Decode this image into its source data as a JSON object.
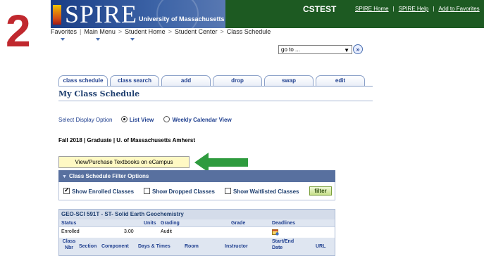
{
  "step_number": "2",
  "header": {
    "logo_text": "SPIRE",
    "logo_subtitle": "University of Massachusetts",
    "environment": "CSTEST",
    "links": [
      "SPIRE Home",
      "SPIRE Help",
      "Add to Favorites"
    ]
  },
  "nav": {
    "favorites": "Favorites",
    "main_menu": "Main Menu",
    "breadcrumb": [
      "Student Home",
      "Student Center",
      "Class Schedule"
    ]
  },
  "goto": {
    "value": "go to ..."
  },
  "tabs": [
    "class schedule",
    "class search",
    "add",
    "drop",
    "swap",
    "edit"
  ],
  "page_title": "My Class Schedule",
  "display_option": {
    "label": "Select Display Option",
    "options": [
      "List View",
      "Weekly Calendar View"
    ],
    "selected": "List View"
  },
  "term": "Fall 2018 | Graduate | U. of Massachusetts Amherst",
  "textbook_button": "View/Purchase Textbooks on eCampus",
  "filter": {
    "heading": "Class Schedule Filter Options",
    "options": [
      {
        "label": "Show Enrolled Classes",
        "checked": true
      },
      {
        "label": "Show Dropped Classes",
        "checked": false
      },
      {
        "label": "Show Waitlisted Classes",
        "checked": false
      }
    ],
    "button": "filter"
  },
  "course": {
    "title": "GEO-SCI 591T - ST- Solid Earth Geochemistry",
    "headers": [
      "Status",
      "Units",
      "Grading",
      "Grade",
      "Deadlines"
    ],
    "values": {
      "status": "Enrolled",
      "units": "3.00",
      "grading": "Audit"
    },
    "class_headers": [
      "Class Nbr",
      "Section",
      "Component",
      "Days & Times",
      "Room",
      "Instructor",
      "Start/End Date",
      "URL"
    ]
  },
  "colors": {
    "header_green": "#1d5a22",
    "arrow_green": "#2e9b3e",
    "step_red": "#c0282e",
    "link_blue": "#1f3f8f"
  }
}
